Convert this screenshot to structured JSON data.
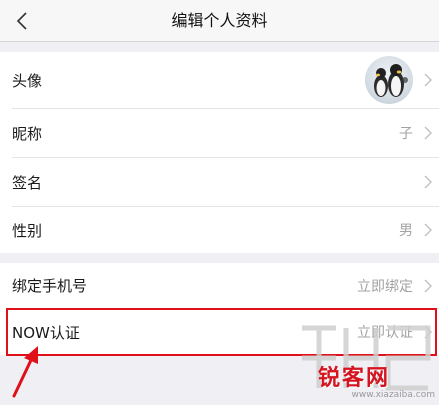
{
  "nav": {
    "title": "编辑个人资料"
  },
  "profile": {
    "rows": [
      {
        "label": "头像",
        "value": ""
      },
      {
        "label": "昵称",
        "value": "子"
      },
      {
        "label": "签名",
        "value": ""
      },
      {
        "label": "性别",
        "value": "男"
      }
    ]
  },
  "account": {
    "rows": [
      {
        "label": "绑定手机号",
        "value": "立即绑定"
      },
      {
        "label": "NOW认证",
        "value": "立即认证"
      }
    ]
  },
  "watermark": {
    "brand": "锐客网",
    "url": "www.xiazaiba.com"
  },
  "colors": {
    "annotation": "#e0101b",
    "page_bg": "#efeff4",
    "value_text": "#a3a3a3"
  }
}
